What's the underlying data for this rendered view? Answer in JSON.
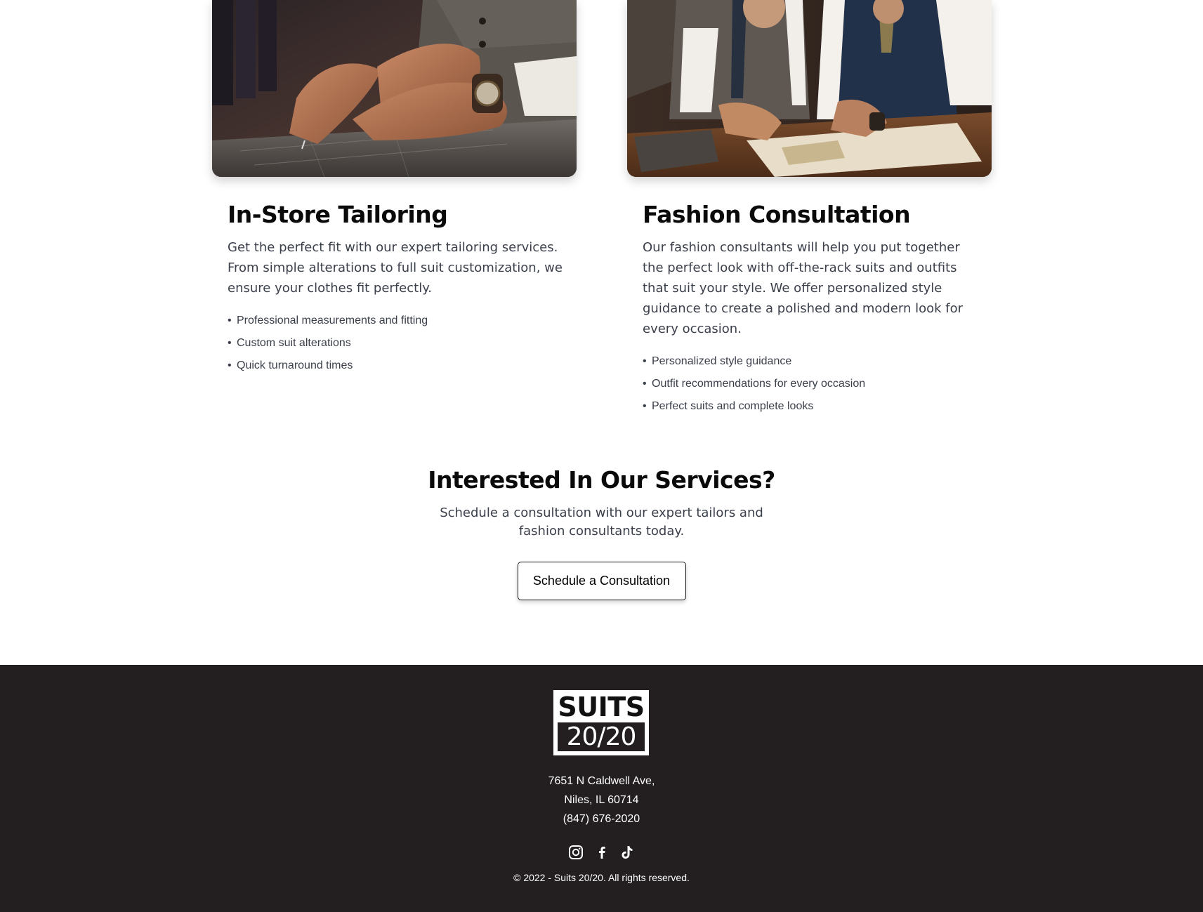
{
  "services": [
    {
      "image_alt": "Tailor hand-stitching suit fabric",
      "title": "In-Store Tailoring",
      "description": "Get the perfect fit with our expert tailoring services. From simple alterations to full suit customization, we ensure your clothes fit perfectly.",
      "features": [
        "Professional measurements and fitting",
        "Custom suit alterations",
        "Quick turnaround times"
      ]
    },
    {
      "image_alt": "Two men reviewing fabric samples",
      "title": "Fashion Consultation",
      "description": "Our fashion consultants will help you put together the perfect look with off-the-rack suits and outfits that suit your style. We offer personalized style guidance to create a polished and modern look for every occasion.",
      "features": [
        "Personalized style guidance",
        "Outfit recommendations for every occasion",
        "Perfect suits and complete looks"
      ]
    }
  ],
  "cta": {
    "title": "Interested In Our Services?",
    "text": "Schedule a consultation with our expert tailors and fashion consultants today.",
    "button_label": "Schedule a Consultation"
  },
  "footer": {
    "logo_top": "SUITS",
    "logo_bottom": "20/20",
    "address_line1": "7651 N Caldwell Ave,",
    "address_line2": "Niles, IL 60714",
    "phone": "(847) 676-2020",
    "social_icons": [
      "instagram-icon",
      "facebook-icon",
      "tiktok-icon"
    ],
    "copyright": "© 2022 - Suits 20/20. All rights reserved."
  },
  "colors": {
    "footer_bg": "#231f20",
    "body_text": "#3a3f4a",
    "heading": "#0a0a0a"
  }
}
